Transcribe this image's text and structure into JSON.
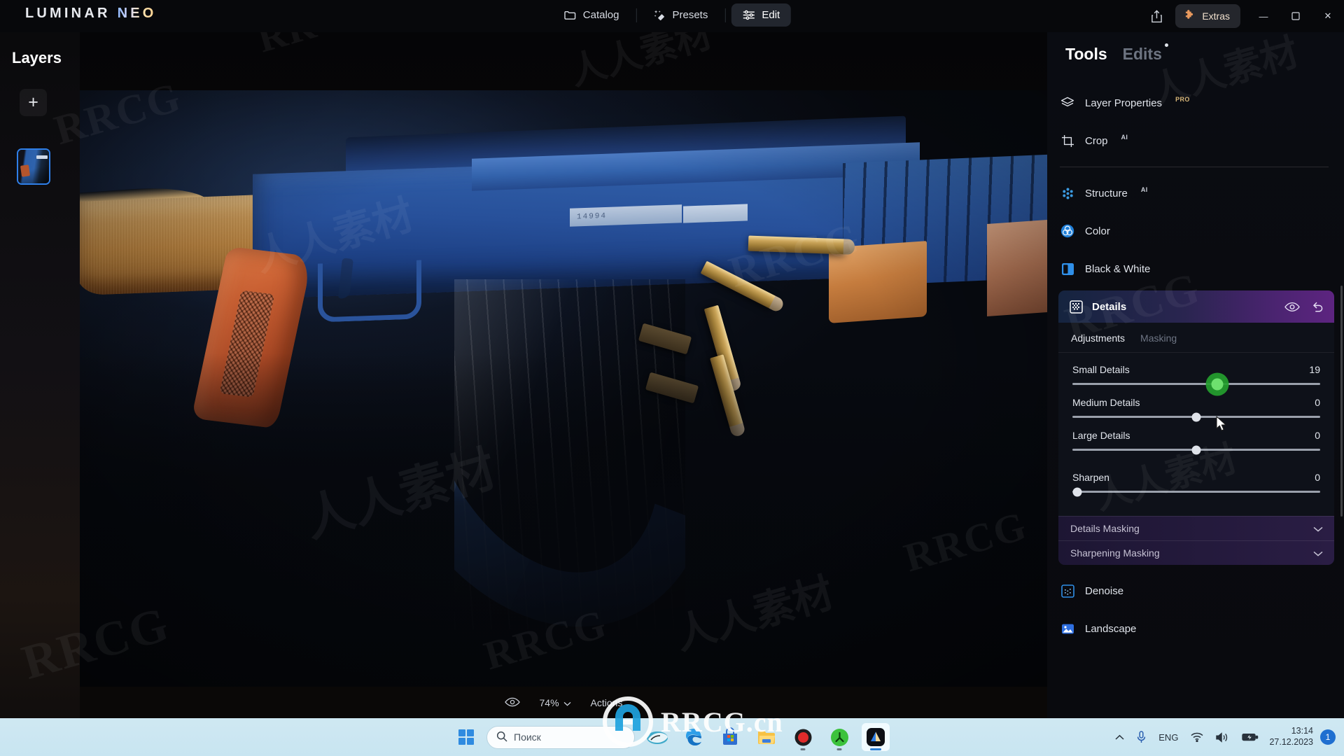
{
  "app": {
    "brand_first": "LUMINAR",
    "brand_second": "NEO"
  },
  "topnav": {
    "catalog": "Catalog",
    "presets": "Presets",
    "edit": "Edit",
    "extras": "Extras",
    "share_icon": "share-icon",
    "minimize": "—",
    "restore": "❐",
    "close": "✕"
  },
  "layers": {
    "title": "Layers",
    "add_label": "+",
    "thumb_name": "layer-thumbnail"
  },
  "canvas": {
    "serial_number": "14994",
    "zoom": "74%",
    "actions": "Actions",
    "preview_icon": "eye-icon",
    "chevron": "∨"
  },
  "tools": {
    "tab_tools": "Tools",
    "tab_edits": "Edits",
    "items_top": [
      {
        "label": "Layer Properties",
        "badge": "PRO",
        "icon": "layers-icon"
      },
      {
        "label": "Crop",
        "badge": "AI",
        "icon": "crop-icon"
      }
    ],
    "items_mid": [
      {
        "label": "Structure",
        "badge": "AI",
        "icon": "structure-icon"
      },
      {
        "label": "Color",
        "badge": "",
        "icon": "color-wheel-icon"
      },
      {
        "label": "Black & White",
        "badge": "",
        "icon": "black-white-icon"
      }
    ],
    "items_bottom": [
      {
        "label": "Denoise",
        "badge": "",
        "icon": "denoise-icon"
      },
      {
        "label": "Landscape",
        "badge": "",
        "icon": "landscape-icon"
      }
    ],
    "details": {
      "title": "Details",
      "icon": "details-icon",
      "eye_icon": "eye-icon",
      "reset_icon": "undo-icon",
      "tabs": [
        {
          "label": "Adjustments",
          "active": true
        },
        {
          "label": "Masking",
          "active": false
        }
      ],
      "sliders": [
        {
          "label": "Small Details",
          "value": "19",
          "percent": 58.5,
          "active": true
        },
        {
          "label": "Medium Details",
          "value": "0",
          "percent": 50,
          "active": false
        },
        {
          "label": "Large Details",
          "value": "0",
          "percent": 50,
          "active": false
        },
        {
          "label": "Sharpen",
          "value": "0",
          "percent": 2,
          "active": false
        }
      ],
      "mask_rows": [
        {
          "label": "Details Masking"
        },
        {
          "label": "Sharpening Masking"
        }
      ]
    }
  },
  "taskbar": {
    "start_icon": "windows-start-icon",
    "search_placeholder": "Поиск",
    "search_icon": "search-icon",
    "apps": [
      {
        "name": "weather-widget-icon"
      },
      {
        "name": "edge-browser-icon"
      },
      {
        "name": "microsoft-store-icon"
      },
      {
        "name": "file-explorer-icon"
      },
      {
        "name": "recorder-icon"
      },
      {
        "name": "sharex-icon"
      },
      {
        "name": "luminar-neo-icon"
      }
    ],
    "tray": {
      "chevron": "∧",
      "mic_icon": "microphone-icon",
      "language": "ENG",
      "wifi_icon": "wifi-icon",
      "volume_icon": "volume-icon",
      "battery_icon": "battery-charging-icon",
      "time": "13:14",
      "date": "27.12.2023",
      "notification_count": "1"
    }
  },
  "watermarks": {
    "rrcg": "RRCG",
    "rrcg_site": "RRCG.cn",
    "cn_text": "人人素材",
    "rr": "RR"
  },
  "colors": {
    "accent_blue": "#2f7fe8",
    "details_gradient_start": "#15243f",
    "details_gradient_end": "#5d2480",
    "slider_active": "#24a02e",
    "pro_badge": "#d9b87a",
    "taskbar": "#cfe8f2"
  }
}
